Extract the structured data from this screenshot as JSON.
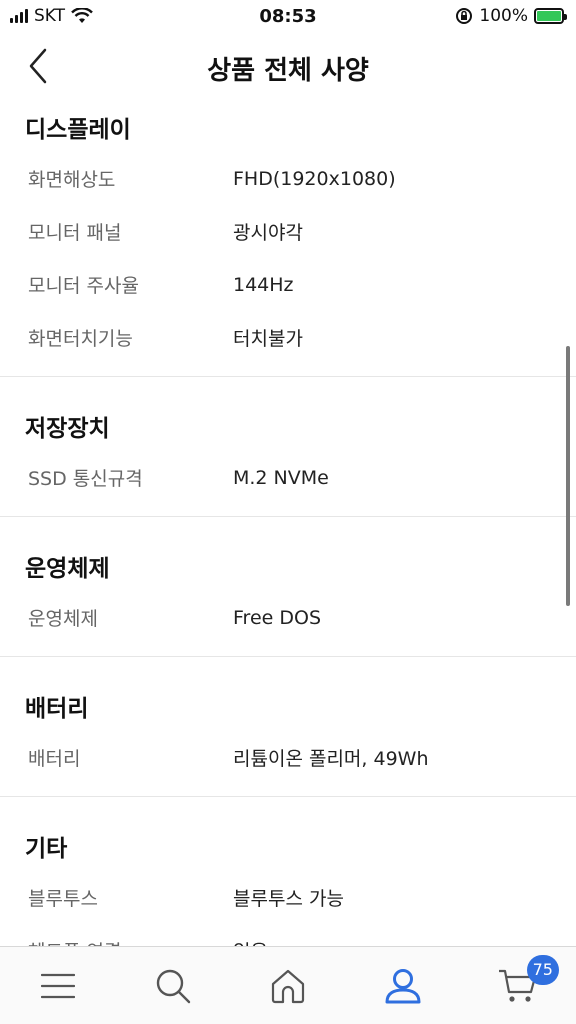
{
  "status_bar": {
    "carrier": "SKT",
    "time": "08:53",
    "battery_percent": "100%",
    "battery_level": 1.0
  },
  "header": {
    "title": "상품 전체 사양"
  },
  "sections": [
    {
      "title": "디스플레이",
      "rows": [
        {
          "label": "화면해상도",
          "value": "FHD(1920x1080)"
        },
        {
          "label": "모니터 패널",
          "value": "광시야각"
        },
        {
          "label": "모니터 주사율",
          "value": "144Hz"
        },
        {
          "label": "화면터치기능",
          "value": "터치불가"
        }
      ]
    },
    {
      "title": "저장장치",
      "rows": [
        {
          "label": "SSD 통신규격",
          "value": "M.2 NVMe"
        }
      ]
    },
    {
      "title": "운영체제",
      "rows": [
        {
          "label": "운영체제",
          "value": "Free DOS"
        }
      ]
    },
    {
      "title": "배터리",
      "rows": [
        {
          "label": "배터리",
          "value": "리튬이온 폴리머, 49Wh"
        }
      ]
    },
    {
      "title": "기타",
      "rows": [
        {
          "label": "블루투스",
          "value": "블루투스 가능"
        },
        {
          "label": "헤드폰 연결",
          "value": "있음"
        }
      ]
    }
  ],
  "tab_bar": {
    "items": [
      {
        "icon": "menu-icon"
      },
      {
        "icon": "search-icon"
      },
      {
        "icon": "home-icon"
      },
      {
        "icon": "user-icon",
        "active": true
      },
      {
        "icon": "cart-icon"
      }
    ],
    "cart_badge": "75"
  },
  "colors": {
    "accent": "#2f6fdf",
    "battery": "#34c759",
    "label_text": "#666666"
  }
}
